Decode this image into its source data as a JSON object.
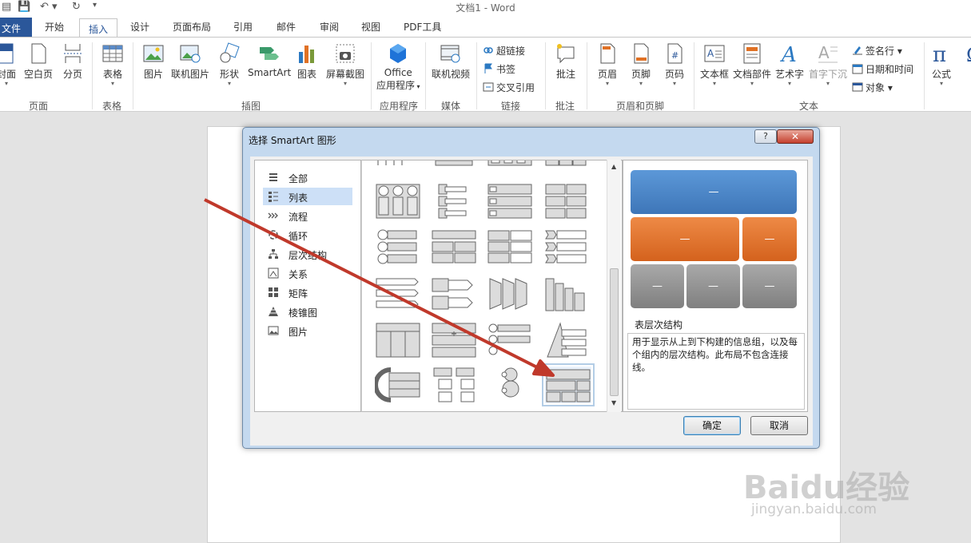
{
  "window": {
    "title": "文档1 - Word"
  },
  "tabs": [
    "文件",
    "开始",
    "插入",
    "设计",
    "页面布局",
    "引用",
    "邮件",
    "审阅",
    "视图",
    "PDF工具"
  ],
  "ribbon": {
    "groups": {
      "pages": "页面",
      "tables": "表格",
      "illustrations": "插图",
      "apps": "应用程序",
      "media": "媒体",
      "links": "链接",
      "comments": "批注",
      "header_footer": "页眉和页脚",
      "text": "文本"
    },
    "buttons": {
      "cover": "封面",
      "blank_page": "空白页",
      "page_break": "分页",
      "table": "表格",
      "picture": "图片",
      "online_picture": "联机图片",
      "shapes": "形状",
      "smartart": "SmartArt",
      "chart": "图表",
      "screenshot": "屏幕截图",
      "office_line1": "Office",
      "office_line2": "应用程序",
      "online_video": "联机视频",
      "hyperlink": "超链接",
      "bookmark": "书签",
      "cross_ref": "交叉引用",
      "comment": "批注",
      "header": "页眉",
      "footer": "页脚",
      "page_number": "页码",
      "textbox": "文本框",
      "quick_parts": "文档部件",
      "wordart": "艺术字",
      "dropcap": "首字下沉",
      "signature": "签名行",
      "datetime": "日期和时间",
      "object": "对象",
      "equation": "公式"
    }
  },
  "dialog": {
    "title": "选择 SmartArt 图形",
    "help": "?",
    "close": "✕",
    "categories": [
      "全部",
      "列表",
      "流程",
      "循环",
      "层次结构",
      "关系",
      "矩阵",
      "棱锥图",
      "图片"
    ],
    "selected_category": "列表",
    "preview": {
      "box_label": "—",
      "name": "表层次结构",
      "description": "用于显示从上到下构建的信息组，以及每个组内的层次结构。此布局不包含连接线。"
    },
    "ok": "确定",
    "cancel": "取消"
  },
  "colors": {
    "file_tab": "#2b579a",
    "arrow": "#c0392b",
    "preview_blue": "#4a86c8",
    "preview_orange": "#e07125",
    "preview_gray": "#8c8c8c"
  },
  "watermark": {
    "logo": "Baidu经验",
    "sub": "jingyan.baidu.com"
  }
}
